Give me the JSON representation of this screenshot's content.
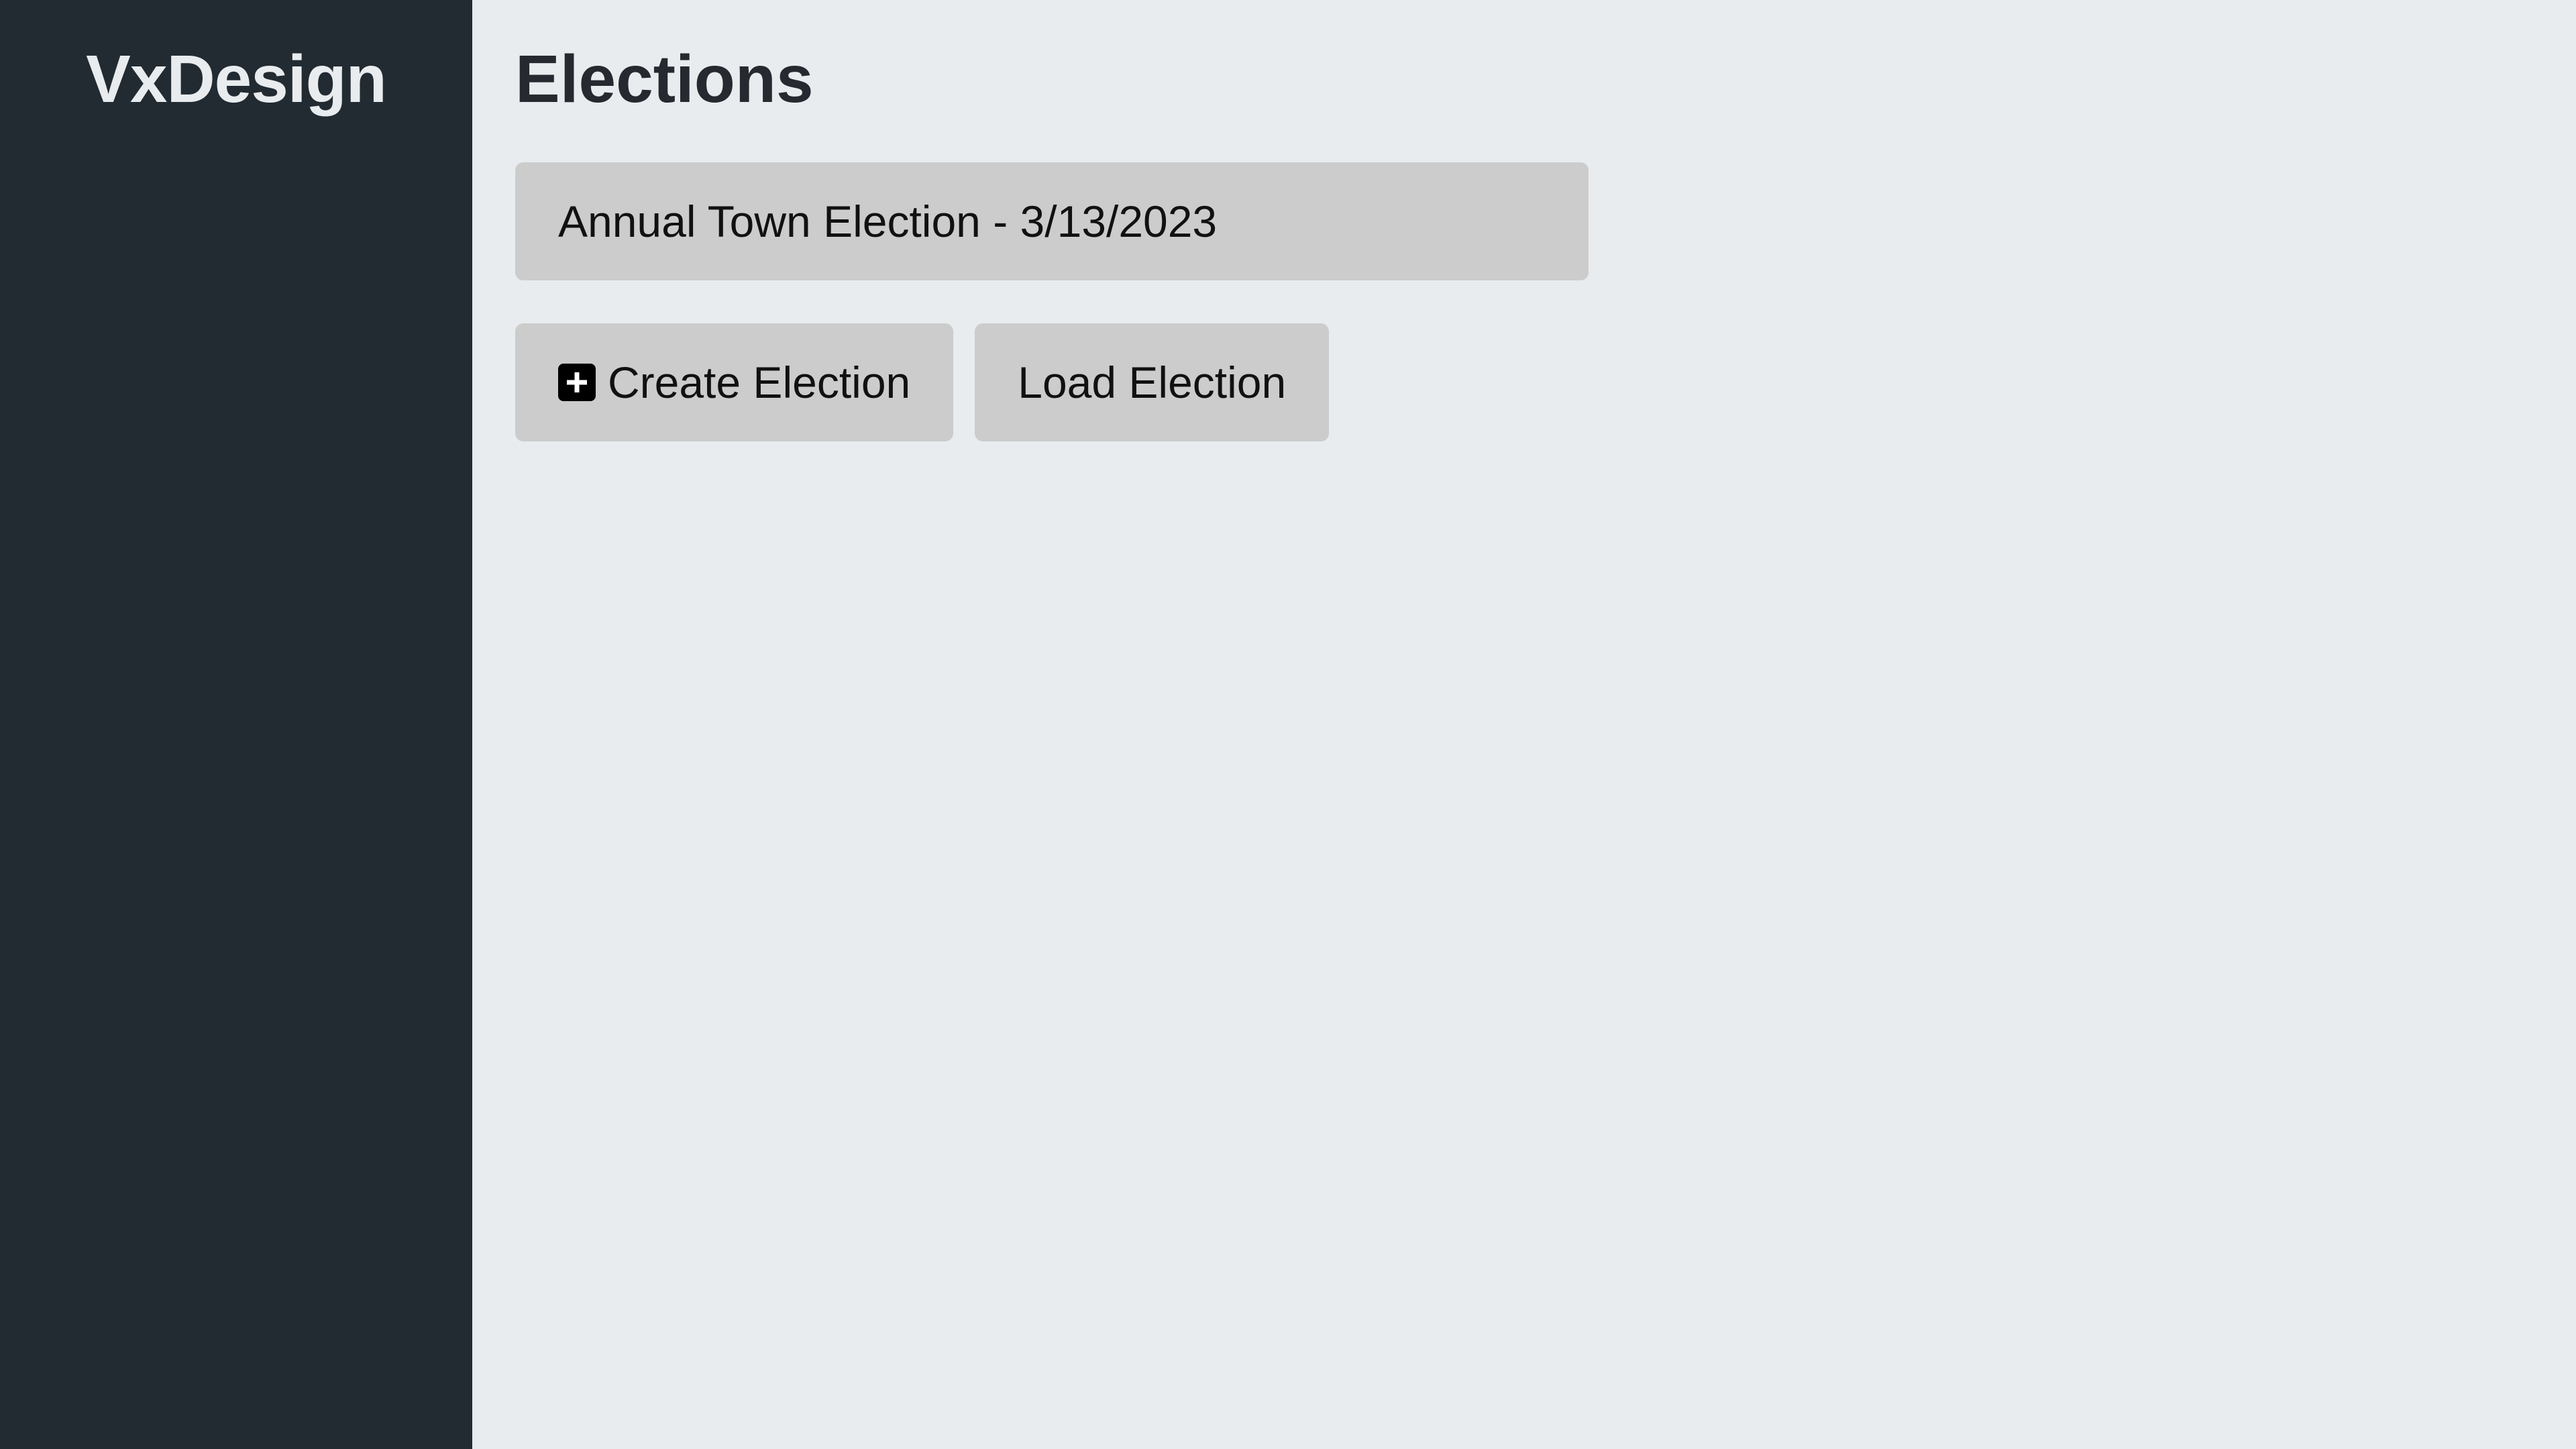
{
  "sidebar": {
    "brand": "VxDesign"
  },
  "main": {
    "title": "Elections",
    "elections": [
      {
        "label": "Annual Town Election - 3/13/2023"
      }
    ],
    "actions": {
      "create_label": "Create Election",
      "create_icon": "plus-square-icon",
      "load_label": "Load Election"
    }
  },
  "colors": {
    "sidebar_bg": "#222a32",
    "main_bg": "#e8ecee",
    "button_bg": "#cccccc"
  }
}
